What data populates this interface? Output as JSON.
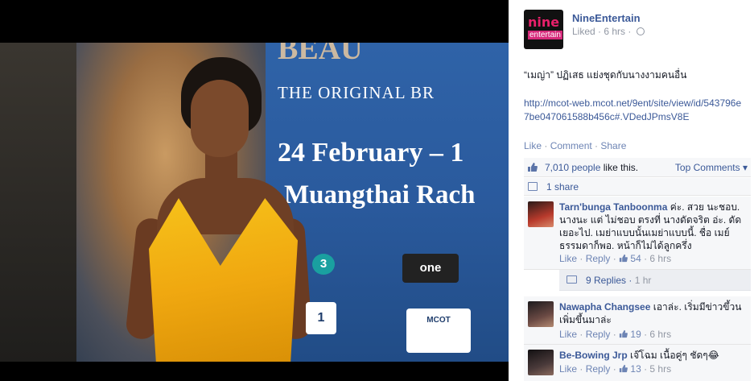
{
  "photo": {
    "poster_title": "BEAU",
    "poster_subtitle": "THE ORIGINAL BR",
    "poster_date": "24 February – 1",
    "poster_venue": "Muangthai Rach",
    "logos": [
      "3",
      "one",
      "1",
      "MCOT"
    ]
  },
  "post": {
    "page_name": "NineEntertain",
    "avatar_line1": "nine",
    "avatar_line2": "entertain",
    "liked_label": "Liked",
    "time": "6 hrs",
    "text": "“เมญ่า” ปฏิเสธ แย่งชุดกับนางงามคนอื่น",
    "link": "http://mcot-web.mcot.net/9ent/site/view/id/543796e7be047061588b456c#.VDedJPmsV8E",
    "actions": {
      "like": "Like",
      "comment": "Comment",
      "share": "Share"
    },
    "likes_count": "7,010 people",
    "likes_suffix": " like this.",
    "top_comments": "Top Comments",
    "shares": "1 share"
  },
  "comments": [
    {
      "name": "Tarn'bunga Tanboonma",
      "text": "ค่ะ. สวย นะชอบ. นางนะ แต่ ไม่ชอบ ตรงที่ นางดัดจริต อ่ะ. ดัดเยอะไป. เมย่าแบบนั้นเมย่าแบบนี้. ชื่อ เมย์ ธรรมดาก็พอ. หน้าก็ไม่ได้ลูกครึ่ง",
      "like": "Like",
      "reply": "Reply",
      "likes": "54",
      "time": "6 hrs",
      "replies_label": "9 Replies",
      "replies_time": "1 hr"
    },
    {
      "name": "Nawapha Changsee",
      "text": "เอาล่ะ. เริ่มมีข่าวขึ้วนเพิ่มขึ้นมาล่ะ",
      "like": "Like",
      "reply": "Reply",
      "likes": "19",
      "time": "6 hrs"
    },
    {
      "name": "Be-Bowing Jrp",
      "text": "เจ๊โฉม เนื้อคู่ๆ ชัดๆ😂",
      "like": "Like",
      "reply": "Reply",
      "likes": "13",
      "time": "5 hrs"
    }
  ],
  "colors": {
    "link": "#3b5998",
    "muted": "#9197a3",
    "panel_bg": "#f6f7f9"
  }
}
